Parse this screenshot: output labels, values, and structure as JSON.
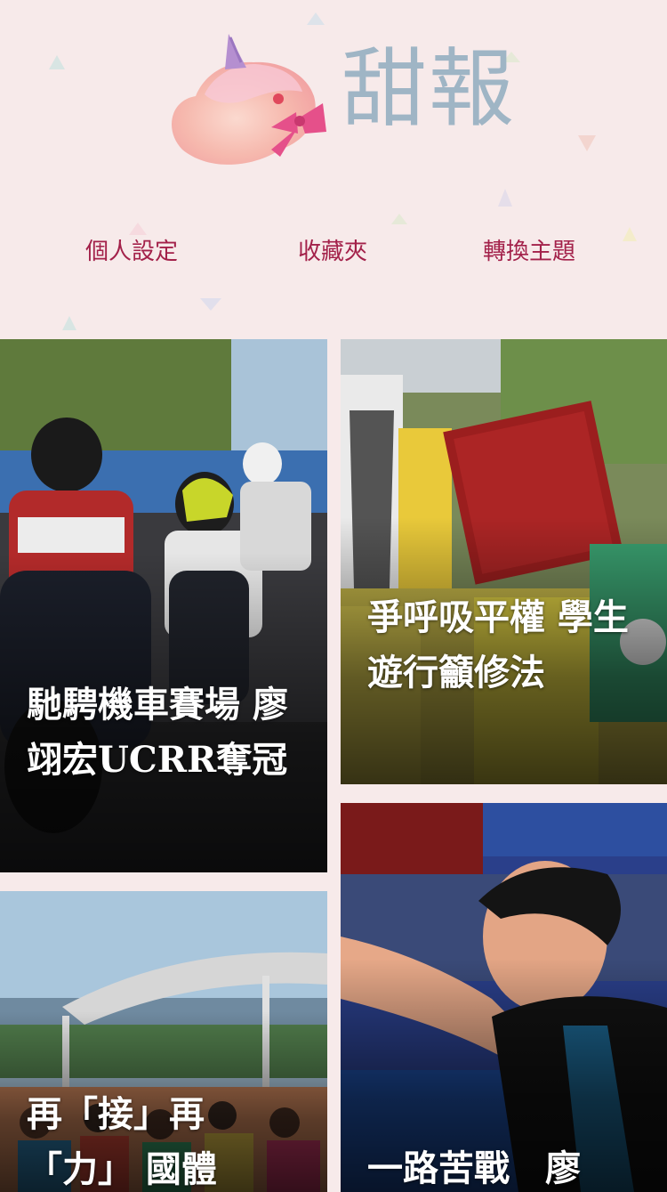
{
  "app": {
    "brand": "甜報"
  },
  "nav": {
    "items": [
      {
        "label": "個人設定"
      },
      {
        "label": "收藏夾"
      },
      {
        "label": "轉換主題"
      }
    ]
  },
  "articles": [
    {
      "title": "馳騁機車賽場 廖翊宏UCRR奪冠"
    },
    {
      "title": "爭呼吸平權 學生遊行籲修法"
    },
    {
      "title": "再「接」再「力」 國體"
    },
    {
      "title": "一路苦戰　廖"
    }
  ],
  "colors": {
    "background": "#f7eaea",
    "nav_text": "#a3214a",
    "brand_text": "#9fb5c5"
  }
}
